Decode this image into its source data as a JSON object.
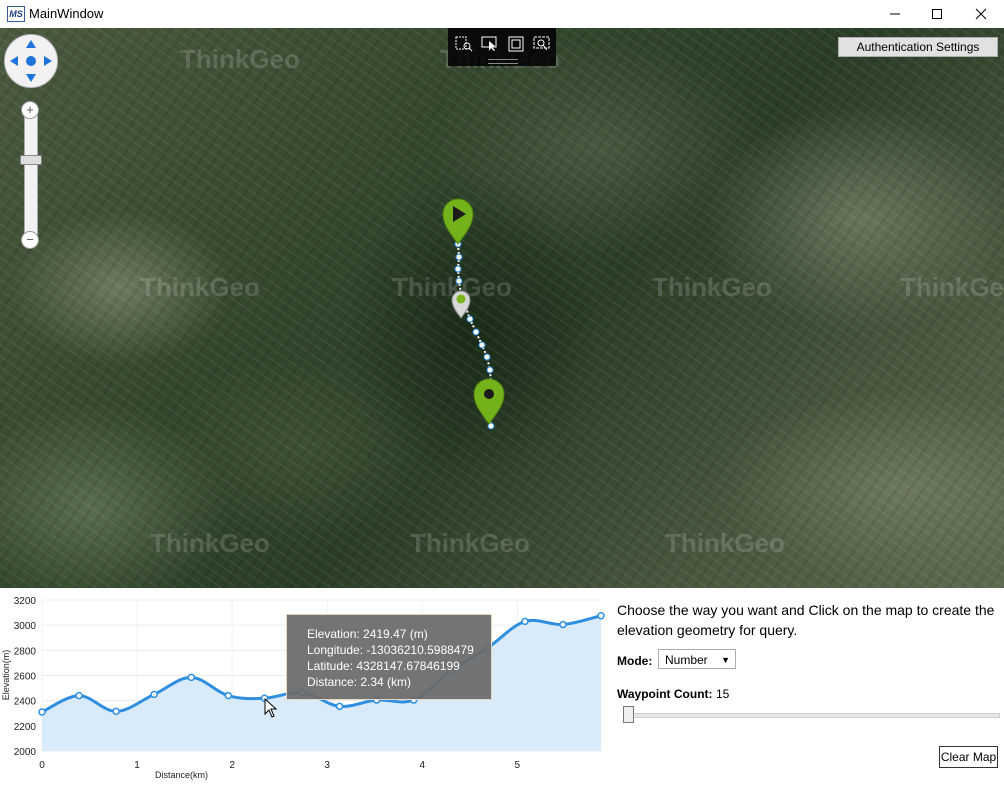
{
  "window": {
    "title": "MainWindow",
    "icon_text": "MS",
    "minimize_icon": "minimize-icon",
    "maximize_icon": "maximize-icon",
    "close_icon": "close-icon"
  },
  "map": {
    "watermark_text": "ThinkGeo",
    "auth_button_label": "Authentication Settings",
    "toolbar_tools": [
      "track-zoom-icon",
      "select-pointer-icon",
      "rectangle-select-icon",
      "zoom-extent-icon"
    ],
    "marker_start_icon": "play-marker-icon",
    "marker_mid_icon": "waypoint-marker-icon",
    "marker_end_icon": "end-marker-icon",
    "route_color": "#2b86d6",
    "marker_color": "#7ab51d"
  },
  "chart_data": {
    "type": "area",
    "xlabel": "Distance(km)",
    "ylabel": "Elevation(m)",
    "xlim": [
      0,
      5.88
    ],
    "ylim": [
      2000,
      3200
    ],
    "x_ticks": [
      "0",
      "1",
      "2",
      "3",
      "4",
      "5"
    ],
    "y_ticks": [
      "3200",
      "3000",
      "2800",
      "2600",
      "2400",
      "2200",
      "2000"
    ],
    "grid": true,
    "x": [
      0,
      0.39,
      0.78,
      1.18,
      1.57,
      1.96,
      2.34,
      2.74,
      3.13,
      3.52,
      3.91,
      4.3,
      4.69,
      5.08,
      5.48,
      5.88
    ],
    "y": [
      2310,
      2440,
      2315,
      2450,
      2585,
      2440,
      2419,
      2465,
      2355,
      2405,
      2405,
      2635,
      2820,
      3030,
      3005,
      3075
    ],
    "line_color": "#2e8fe0",
    "fill_color": "#d9ebfa",
    "highlight_index": 6
  },
  "tooltip": {
    "elevation": "Elevation: 2419.47 (m)",
    "longitude": "Longitude: -13036210.5988479",
    "latitude": "Latitude: 4328147.67846199",
    "distance": "Distance: 2.34 (km)"
  },
  "panel": {
    "instruction": "Choose the way you want and Click on the map to create the elevation geometry for query.",
    "mode_label": "Mode:",
    "mode_value": "Number",
    "waypoint_label": "Waypoint Count:",
    "waypoint_value": "15",
    "waypoint_slider_fraction": 0.0,
    "clear_button_label": "Clear Map"
  }
}
